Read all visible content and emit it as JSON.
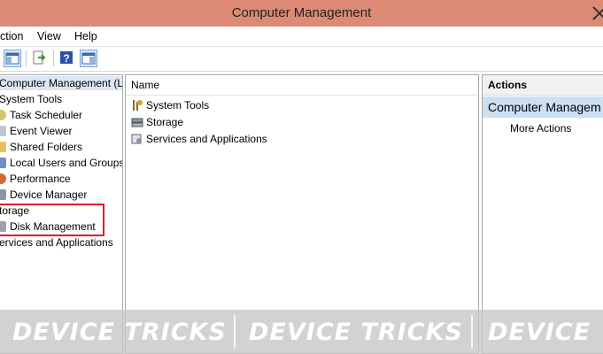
{
  "window": {
    "title": "Computer Management"
  },
  "menu": {
    "action": "ction",
    "view": "View",
    "help": "Help"
  },
  "toolbar": {
    "icons": [
      "show-tree-icon",
      "export-list-icon",
      "help-icon",
      "show-action-pane-icon"
    ]
  },
  "tree": {
    "root": "Computer Management (Local",
    "items": [
      "System Tools",
      "Task Scheduler",
      "Event Viewer",
      "Shared Folders",
      "Local Users and Groups",
      "Performance",
      "Device Manager",
      "torage",
      "Disk Management",
      "ervices and Applications"
    ]
  },
  "middle": {
    "header": "Name",
    "rows": [
      "System Tools",
      "Storage",
      "Services and Applications"
    ]
  },
  "actions": {
    "header": "Actions",
    "selected": "Computer Managem",
    "more": "More Actions"
  },
  "watermark": {
    "text_1": "DEVICE TRICKS",
    "text_2": "DEVICE TRICKS",
    "text_3": "DEVICE"
  },
  "colors": {
    "titlebar": "#dc8a76",
    "highlight": "#e11b2b",
    "selection": "#cde0f2"
  }
}
